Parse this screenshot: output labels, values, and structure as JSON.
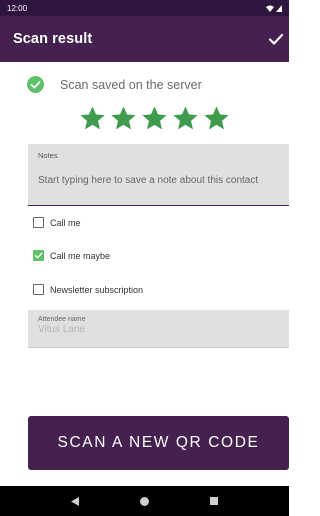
{
  "status_bar": {
    "time": "12:00"
  },
  "app_bar": {
    "title": "Scan result",
    "action_icon": "check-icon"
  },
  "saved": {
    "text": "Scan saved on the server",
    "icon": "check-circle-icon",
    "color": "#5ec16a"
  },
  "rating": {
    "value": 5,
    "max": 5,
    "color": "#3f9c4f"
  },
  "notes": {
    "label": "Notes",
    "placeholder": "Start typing here to save a note about this contact"
  },
  "options": [
    {
      "label": "Call me",
      "checked": false
    },
    {
      "label": "Call me maybe",
      "checked": true
    },
    {
      "label": "Newsletter subscription",
      "checked": false
    }
  ],
  "attendee": {
    "label": "Attendee name",
    "value": "Vitus Lane"
  },
  "scan_button": {
    "label": "SCAN A NEW QR CODE"
  },
  "colors": {
    "primary": "#45214f",
    "status_bar": "#2f163f",
    "accent_green": "#5ec16a"
  }
}
